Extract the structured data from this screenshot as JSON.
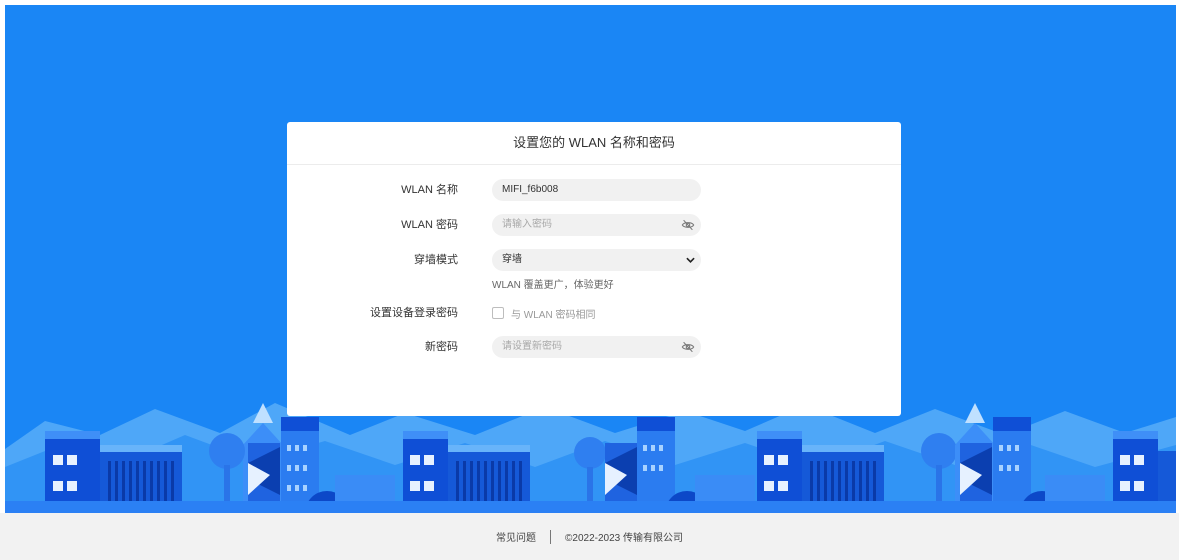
{
  "dialog": {
    "title": "设置您的 WLAN 名称和密码",
    "wlan_name": {
      "label": "WLAN 名称",
      "value": "MIFI_f6b008"
    },
    "wlan_password": {
      "label": "WLAN 密码",
      "placeholder": "请输入密码"
    },
    "wall_mode": {
      "label": "穿墙模式",
      "selected": "穿墙",
      "hint": "WLAN 覆盖更广，体验更好"
    },
    "device_login_password": {
      "label": "设置设备登录密码",
      "checkbox_label": "与 WLAN 密码相同"
    },
    "new_password": {
      "label": "新密码",
      "placeholder": "请设置新密码"
    }
  },
  "footer": {
    "faq": "常见问题",
    "copyright": "©2022-2023 传输有限公司"
  },
  "colors": {
    "background_blue": "#1a86f5",
    "footer_gray": "#f2f2f2"
  },
  "icons": [
    "eye-off-icon",
    "chevron-down-icon",
    "checkbox"
  ]
}
